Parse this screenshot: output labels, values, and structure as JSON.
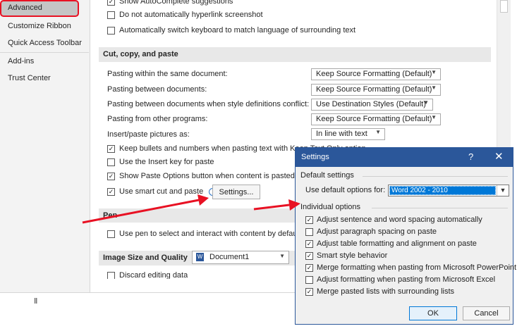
{
  "sidebar": {
    "items": [
      "Advanced",
      "Customize Ribbon",
      "Quick Access Toolbar",
      "Add-ins",
      "Trust Center"
    ],
    "highlight_color": "#e81123"
  },
  "general_options": {
    "autocomplete": "Show AutoComplete suggestions",
    "no_hyperlink": "Do not automatically hyperlink screenshot",
    "keyboard_switch": "Automatically switch keyboard to match language of surrounding text"
  },
  "cut_copy_paste": {
    "header": "Cut, copy, and paste",
    "within_label": "Pasting within the same document:",
    "within_value": "Keep Source Formatting (Default)",
    "between_label": "Pasting between documents:",
    "between_value": "Keep Source Formatting (Default)",
    "conflict_label": "Pasting between documents when style definitions conflict:",
    "conflict_value": "Use Destination Styles (Default)",
    "other_label": "Pasting from other programs:",
    "other_value": "Keep Source Formatting (Default)",
    "pictures_label": "Insert/paste pictures as:",
    "pictures_value": "In line with text",
    "keep_bullets": "Keep bullets and numbers when pasting text with Keep Text Only option",
    "insert_key": "Use the Insert key for paste",
    "show_paste_options": "Show Paste Options button when content is pasted",
    "smart_cut": "Use smart cut and paste",
    "settings_button": "Settings..."
  },
  "pen": {
    "header": "Pen",
    "use_pen": "Use pen to select and interact with content by default"
  },
  "image_size": {
    "header": "Image Size and Quality",
    "document": "Document1",
    "discard_partial": "Discard editing data"
  },
  "dialog": {
    "title": "Settings",
    "help": "?",
    "close": "✕",
    "default_settings": "Default settings",
    "use_default_label": "Use default options for:",
    "use_default_value": "Word 2002 - 2010",
    "individual_options": "Individual options",
    "options": [
      "Adjust sentence and word spacing automatically",
      "Adjust paragraph spacing on paste",
      "Adjust table formatting and alignment on paste",
      "Smart style behavior",
      "Merge formatting when pasting from Microsoft PowerPoint",
      "Adjust formatting when pasting from Microsoft Excel",
      "Merge pasted lists with surrounding lists"
    ],
    "ok": "OK",
    "cancel": "Cancel",
    "titlebar_color": "#2b579a"
  },
  "annotation_arrow_color": "#e81123"
}
